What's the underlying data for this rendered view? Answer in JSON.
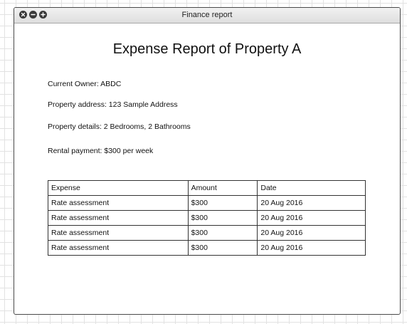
{
  "window": {
    "title": "Finance report",
    "controls": [
      "close-icon",
      "minimize-icon",
      "maximize-icon"
    ]
  },
  "report": {
    "title": "Expense Report of Property A",
    "fields": {
      "owner": "Current Owner: ABDC",
      "address": "Property address: 123 Sample Address",
      "details": "Property details: 2 Bedrooms, 2 Bathrooms",
      "rental": "Rental payment: $300 per week"
    }
  },
  "table": {
    "headers": [
      "Expense",
      "Amount",
      "Date"
    ],
    "rows": [
      [
        "Rate assessment",
        "$300",
        "20 Aug 2016"
      ],
      [
        "Rate assessment",
        "$300",
        "20 Aug 2016"
      ],
      [
        "Rate assessment",
        "$300",
        "20 Aug 2016"
      ],
      [
        "Rate assessment",
        "$300",
        "20 Aug 2016"
      ]
    ]
  },
  "colors": {
    "window_border": "#4a4a4a",
    "grid_line": "#e2e2e2",
    "titlebar": "#e8e8e8"
  }
}
